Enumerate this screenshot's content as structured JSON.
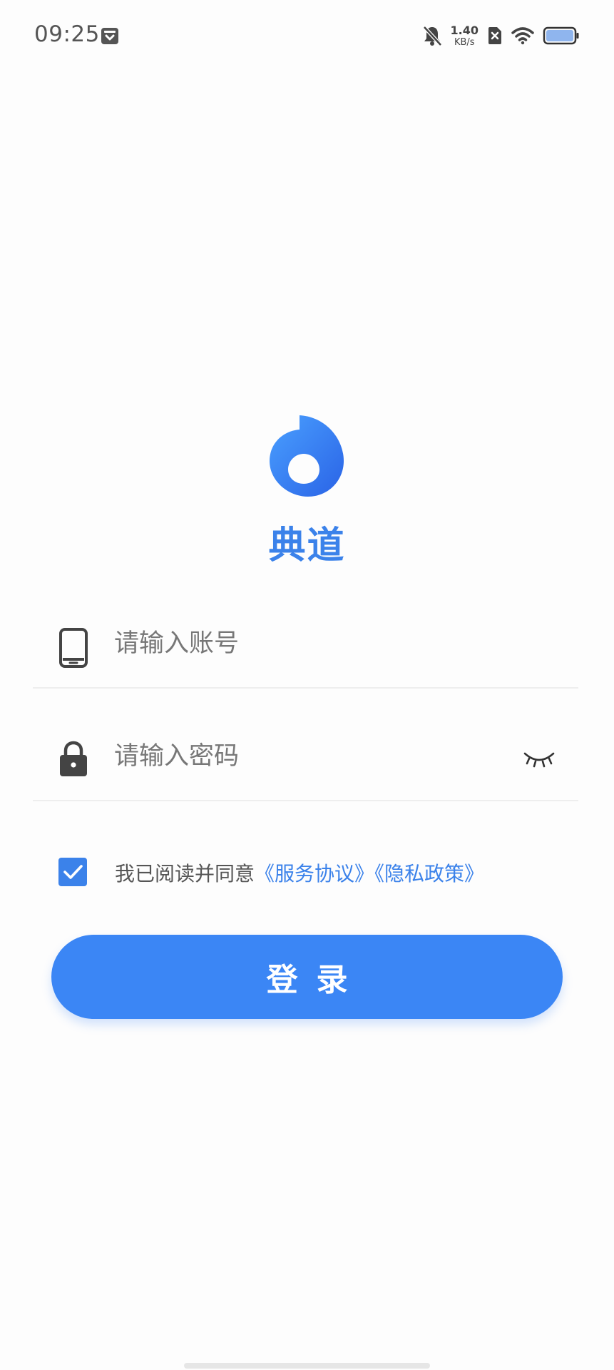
{
  "status_bar": {
    "time": "09:25",
    "net_speed_value": "1.40",
    "net_speed_unit": "KB/s",
    "icons": [
      "notification-icon",
      "bell-muted-icon",
      "sim-off-icon",
      "wifi-icon",
      "battery-icon"
    ]
  },
  "app": {
    "name": "典道",
    "brand_color": "#3b82ea"
  },
  "form": {
    "account_placeholder": "请输入账号",
    "account_value": "",
    "password_placeholder": "请输入密码",
    "password_value": "",
    "agreement_checked": true,
    "agreement_prefix": "我已阅读并同意",
    "service_link": "《服务协议》",
    "privacy_link": "《隐私政策》",
    "login_label": "登录"
  }
}
